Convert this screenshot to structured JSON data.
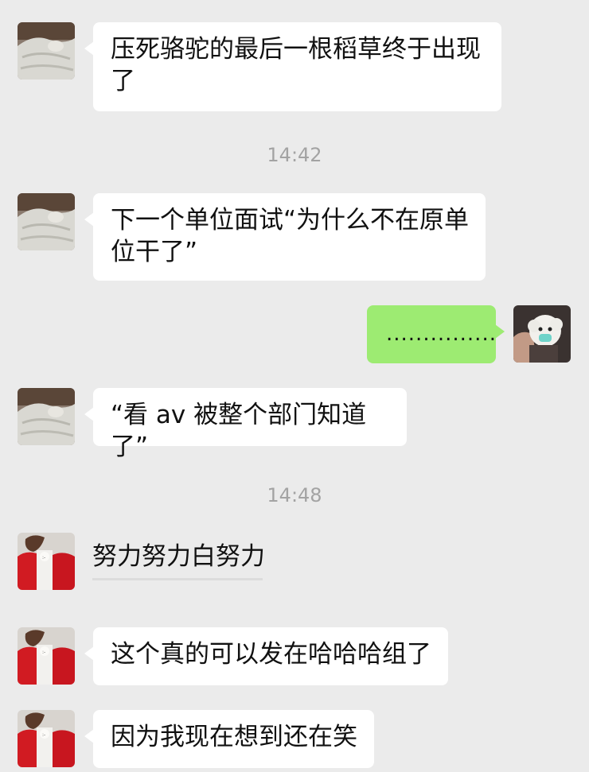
{
  "conversation": {
    "messages": [
      {
        "side": "left",
        "text": "压死骆驼的最后一根稻草终于出现了",
        "avatar": "blanket-avatar"
      },
      {
        "side": "left",
        "text": "下一个单位面试“为什么不在原单位干了”",
        "avatar": "blanket-avatar"
      },
      {
        "side": "right",
        "text": "...............",
        "avatar": "puppy-mask-avatar"
      },
      {
        "side": "left",
        "text": "“看 av 被整个部门知道了”",
        "avatar": "blanket-avatar"
      },
      {
        "side": "left",
        "text": "努力努力白努力",
        "avatar": "red-sweater-avatar"
      },
      {
        "side": "left",
        "text": "这个真的可以发在哈哈哈组了",
        "avatar": "red-sweater-avatar"
      },
      {
        "side": "left",
        "text": "因为我现在想到还在笑",
        "avatar": "red-sweater-avatar"
      }
    ],
    "timestamps": [
      "14:42",
      "14:48"
    ]
  },
  "colors": {
    "background": "#ebebeb",
    "incoming_bubble": "#ffffff",
    "outgoing_bubble": "#9deb72",
    "timestamp_text": "#a3a3a3"
  }
}
